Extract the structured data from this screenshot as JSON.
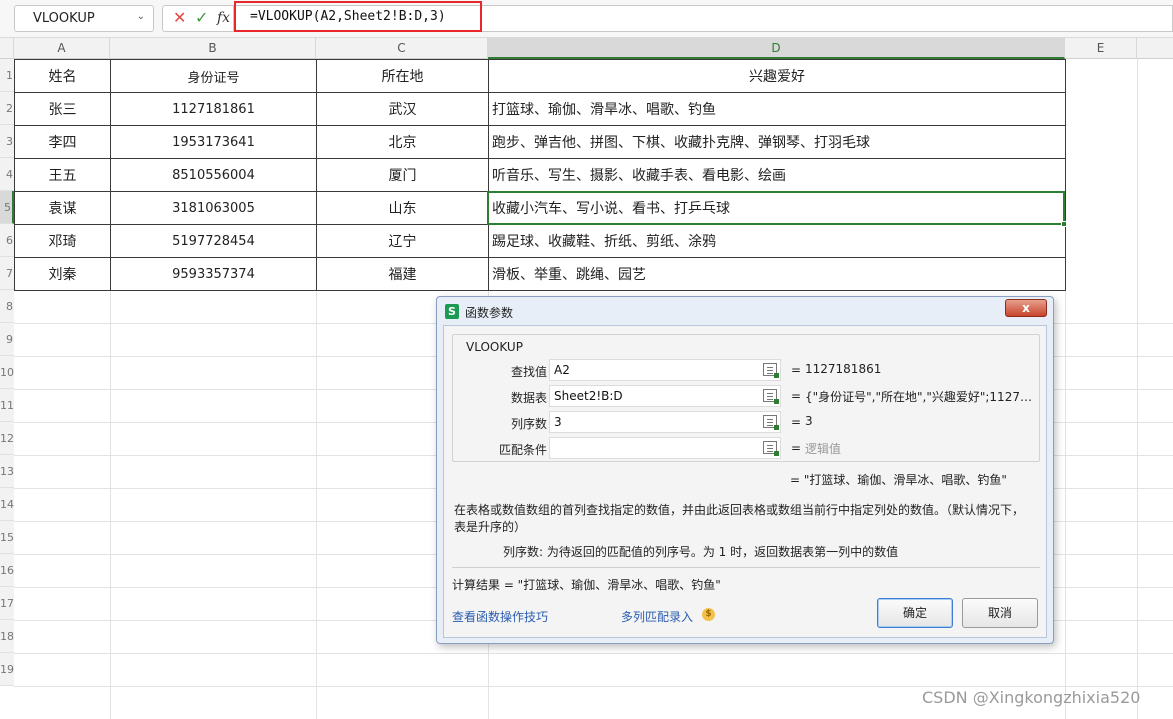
{
  "formula_bar": {
    "name_box": "VLOOKUP",
    "formula": "=VLOOKUP(A2,Sheet2!B:D,3)"
  },
  "columns": [
    "A",
    "B",
    "C",
    "D",
    "E"
  ],
  "row_numbers": [
    "1",
    "2",
    "3",
    "4",
    "5",
    "6",
    "7",
    "8",
    "9",
    "10",
    "11",
    "12",
    "13",
    "14",
    "15",
    "16",
    "17",
    "18",
    "19"
  ],
  "table": {
    "headers": [
      "姓名",
      "身份证号",
      "所在地",
      "兴趣爱好"
    ],
    "rows": [
      [
        "张三",
        "1127181861",
        "武汉",
        "打篮球、瑜伽、滑旱冰、唱歌、钓鱼"
      ],
      [
        "李四",
        "1953173641",
        "北京",
        "跑步、弹吉他、拼图、下棋、收藏扑克牌、弹钢琴、打羽毛球"
      ],
      [
        "王五",
        "8510556004",
        "厦门",
        "听音乐、写生、摄影、收藏手表、看电影、绘画"
      ],
      [
        "袁谋",
        "3181063005",
        "山东",
        "收藏小汽车、写小说、看书、打乒乓球"
      ],
      [
        "邓琦",
        "5197728454",
        "辽宁",
        "踢足球、收藏鞋、折纸、剪纸、涂鸦"
      ],
      [
        "刘秦",
        "9593357374",
        "福建",
        "滑板、举重、跳绳、园艺"
      ]
    ]
  },
  "dialog": {
    "app_badge": "S",
    "title": "函数参数",
    "close": "x",
    "function_name": "VLOOKUP",
    "params": [
      {
        "label": "查找值",
        "value": "A2",
        "result": "1127181861"
      },
      {
        "label": "数据表",
        "value": "Sheet2!B:D",
        "result": "{\"身份证号\",\"所在地\",\"兴趣爱好\";112718..."
      },
      {
        "label": "列序数",
        "value": "3",
        "result": "3"
      },
      {
        "label": "匹配条件",
        "value": "",
        "result": "逻辑值"
      }
    ],
    "equals": "=",
    "result_line": "= \"打篮球、瑜伽、滑旱冰、唱歌、钓鱼\"",
    "description": "在表格或数值数组的首列查找指定的数值，并由此返回表格或数组当前行中指定列处的数值。（默认情况下，表是升序的）",
    "arg_description": "列序数:  为待返回的匹配值的列序号。为 1 时，返回数据表第一列中的数值",
    "calc_result": "计算结果 = \"打篮球、瑜伽、滑旱冰、唱歌、钓鱼\"",
    "link_tips": "查看函数操作技巧",
    "link_multi": "多列匹配录入",
    "coin_icon": "$",
    "ok": "确定",
    "cancel": "取消"
  },
  "watermark": "CSDN @Xingkongzhixia520",
  "colors": {
    "accent_green": "#2f7d32",
    "highlight_red": "#e8262b"
  }
}
